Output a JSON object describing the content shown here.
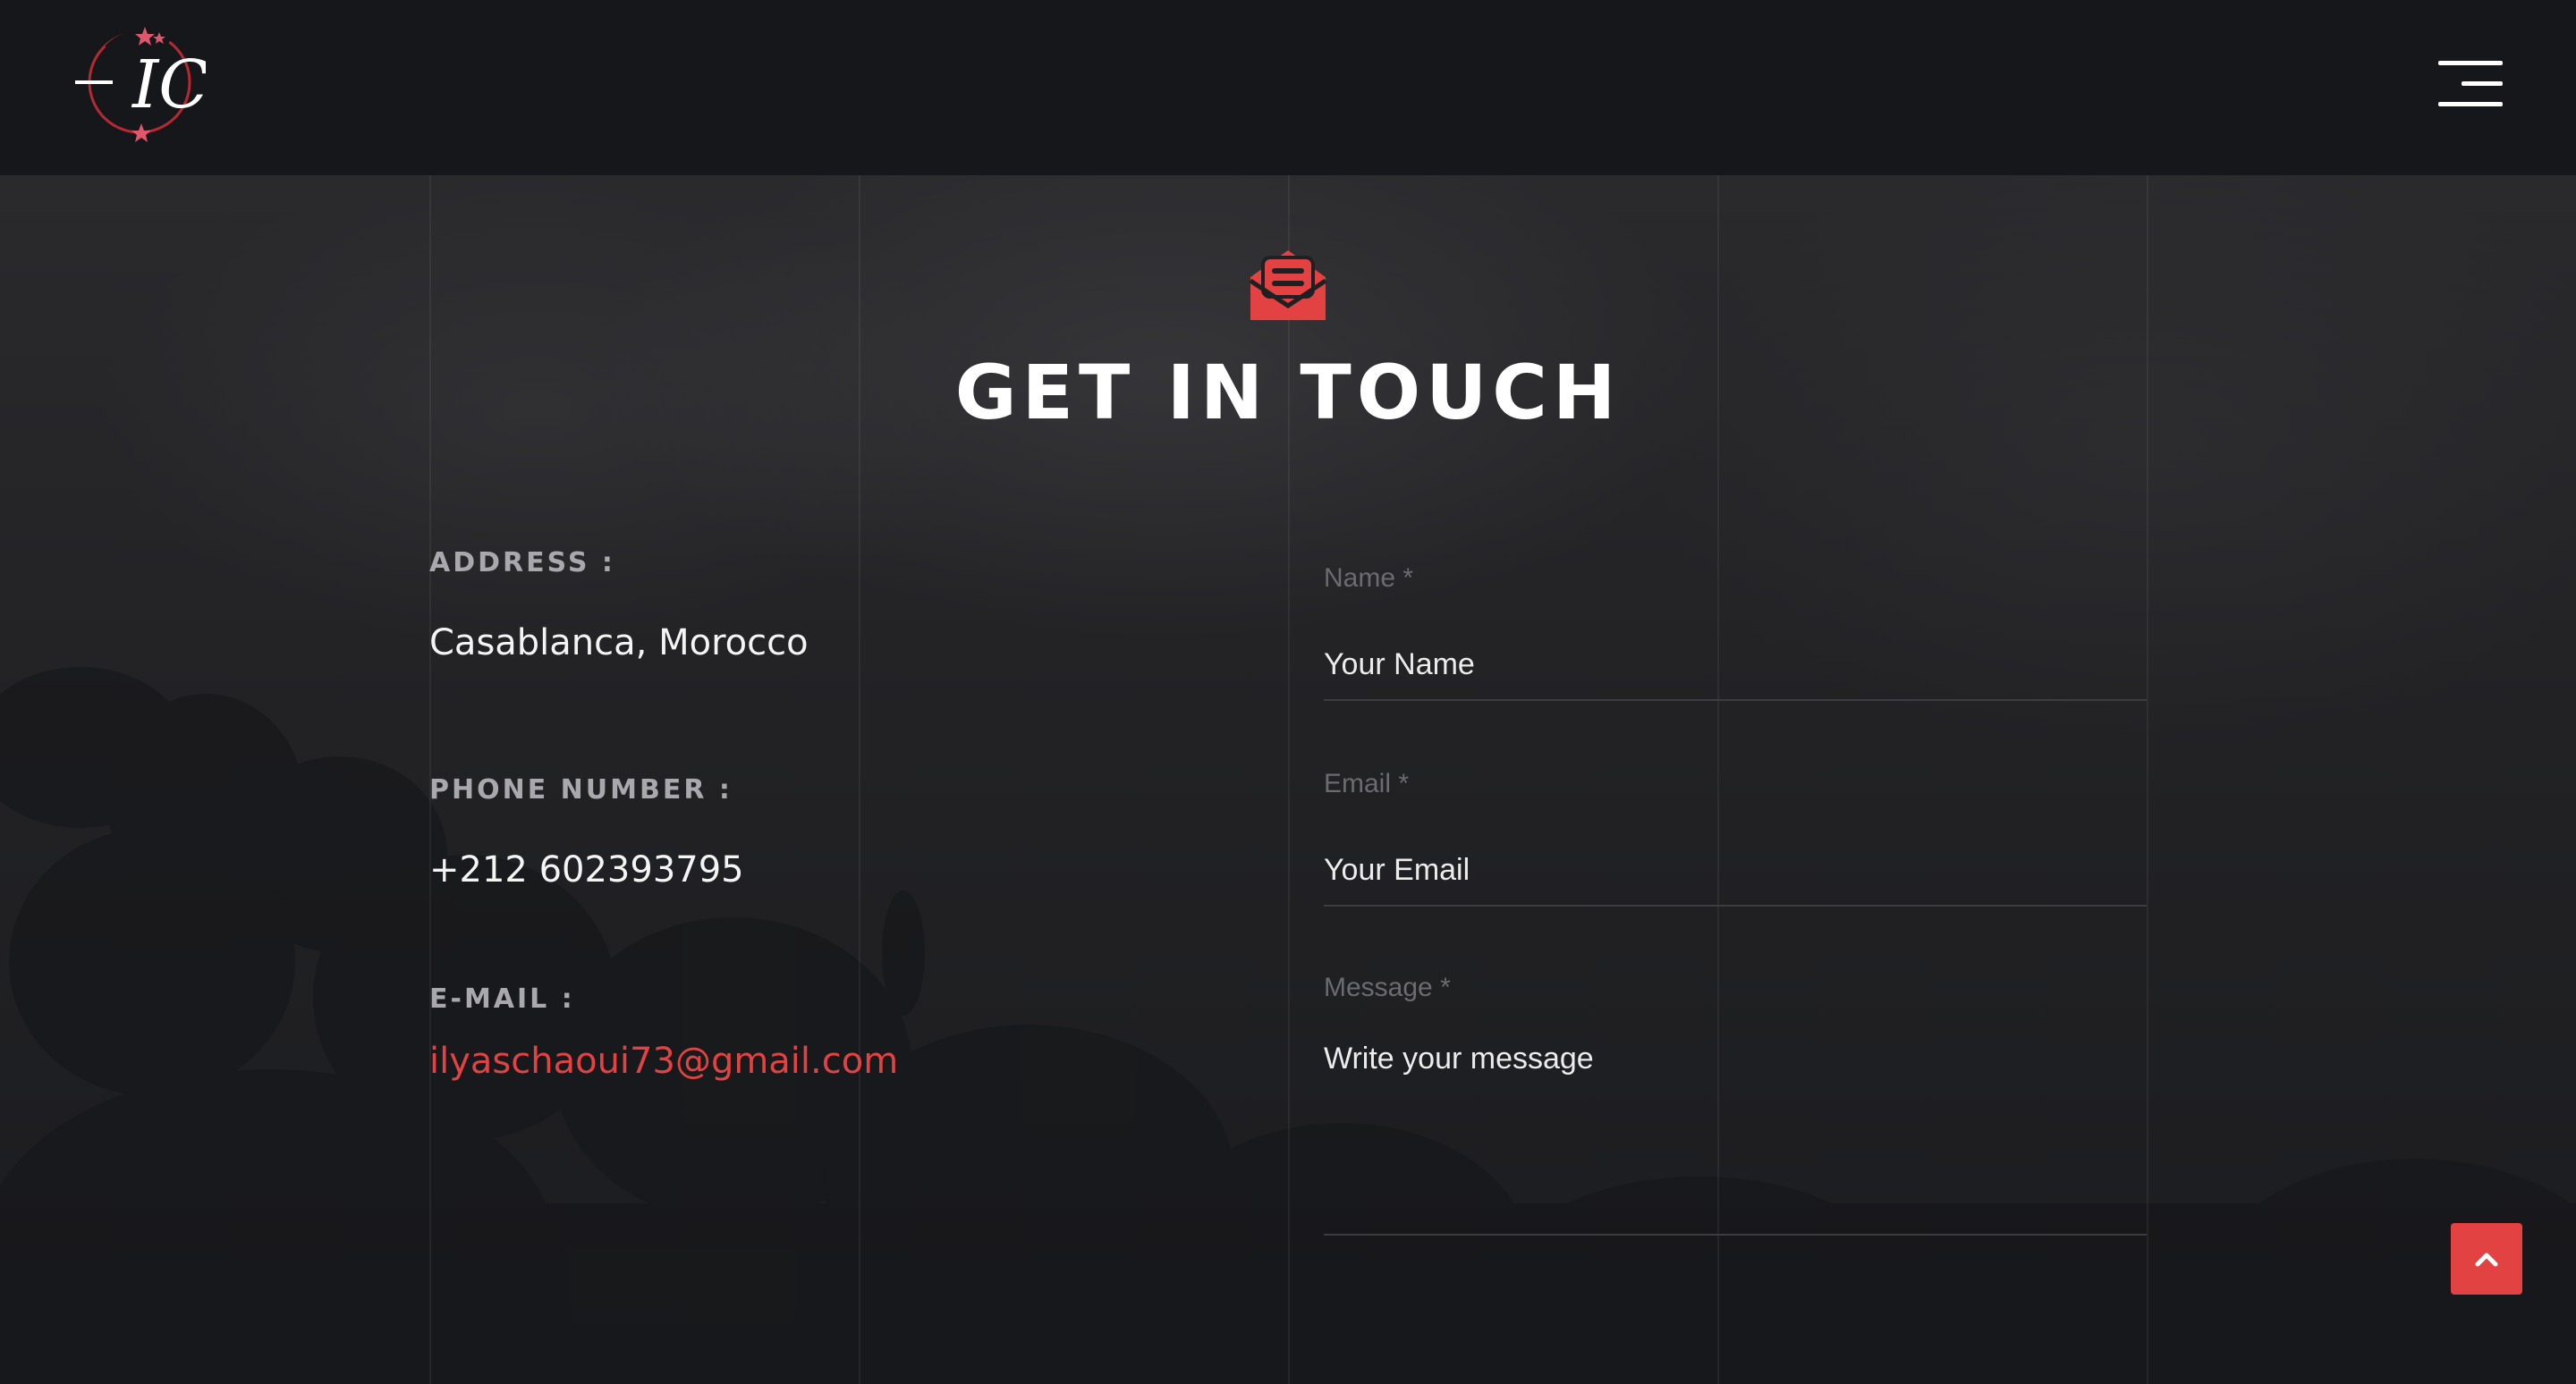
{
  "header": {
    "logo_text": "IC",
    "menu_icon": "hamburger-menu-icon"
  },
  "contact": {
    "icon": "envelope-open-icon",
    "title": "GET IN TOUCH",
    "address_label": "ADDRESS :",
    "address_value": "Casablanca, Morocco",
    "phone_label": "PHONE NUMBER :",
    "phone_value": "+212 602393795",
    "email_label": "E-MAIL :",
    "email_value": "ilyaschaoui73@gmail.com"
  },
  "form": {
    "name_label": "Name *",
    "name_placeholder": "Your Name",
    "email_label": "Email *",
    "email_placeholder": "Your Email",
    "message_label": "Message *",
    "message_placeholder": "Write your message"
  },
  "back_to_top_icon": "chevron-up-icon",
  "colors": {
    "accent": "#e34242",
    "header_bg": "#16171b",
    "text": "#ffffff",
    "label": "#a9a9ad"
  }
}
